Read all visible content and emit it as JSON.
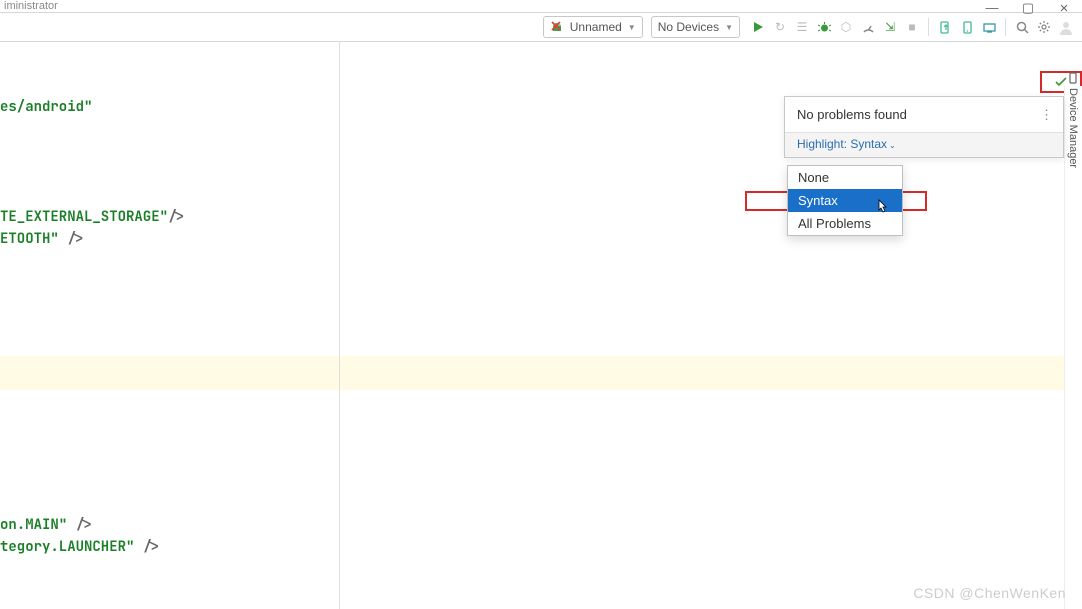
{
  "window": {
    "title_fragment": "iministrator"
  },
  "toolbar": {
    "config_label": "Unnamed",
    "devices_label": "No Devices"
  },
  "editor": {
    "code_fragments": {
      "attr_android": "es/android\"",
      "perm_ext": "TE_EXTERNAL_STORAGE\"",
      "perm_bt": "ETOOTH\"",
      "action_main": "on.MAIN\"",
      "cat_launcher": "tegory.LAUNCHER\"",
      "self_close": "/>",
      "space": " "
    }
  },
  "inspection": {
    "status": "No problems found",
    "highlight_label": "Highlight: Syntax",
    "options": [
      "None",
      "Syntax",
      "All Problems"
    ]
  },
  "side": {
    "device_manager": "Device Manager"
  },
  "watermark": "CSDN @ChenWenKen"
}
